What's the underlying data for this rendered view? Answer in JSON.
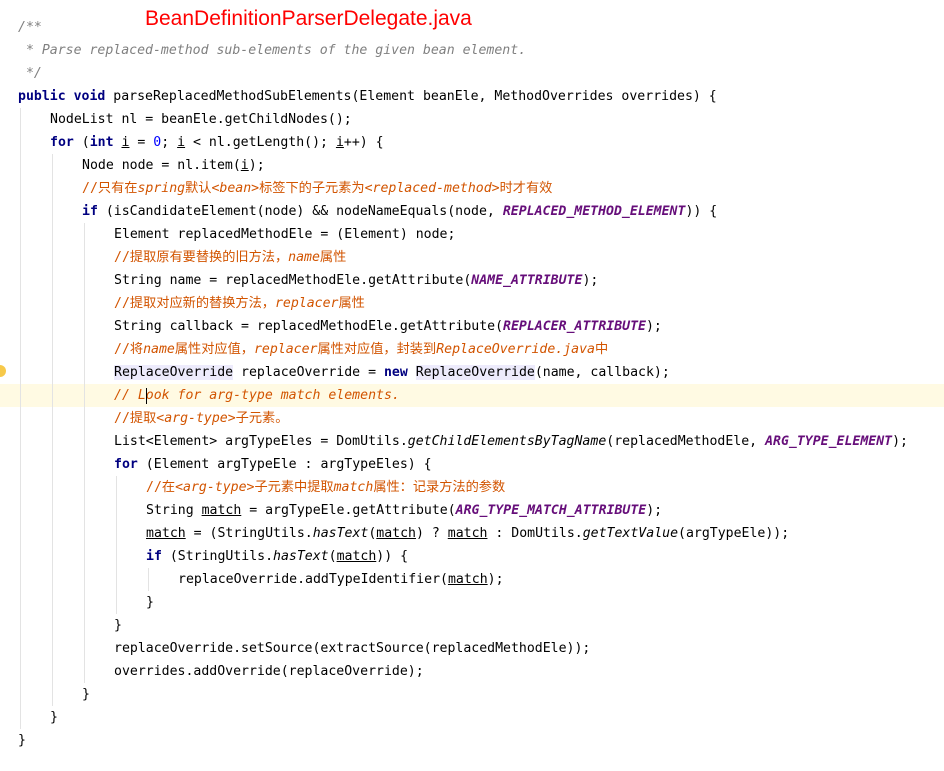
{
  "header": {
    "file_title": "BeanDefinitionParserDelegate.java"
  },
  "editor": {
    "current_line": 16,
    "lines": [
      {
        "indent": 0,
        "tokens": [
          {
            "t": "/**",
            "c": "com"
          }
        ]
      },
      {
        "indent": 0,
        "tokens": [
          {
            "t": " * Parse replaced-method sub-elements of the given bean element.",
            "c": "com"
          }
        ]
      },
      {
        "indent": 0,
        "tokens": [
          {
            "t": " */",
            "c": "com"
          }
        ]
      },
      {
        "indent": 0,
        "tokens": [
          {
            "t": "public",
            "c": "kw"
          },
          {
            "t": " "
          },
          {
            "t": "void",
            "c": "kw"
          },
          {
            "t": " parseReplacedMethodSubElements(Element beanEle, MethodOverrides overrides) {"
          }
        ]
      },
      {
        "indent": 1,
        "tokens": [
          {
            "t": "NodeList nl = beanEle.getChildNodes();"
          }
        ]
      },
      {
        "indent": 1,
        "tokens": [
          {
            "t": "for",
            "c": "kw"
          },
          {
            "t": " ("
          },
          {
            "t": "int",
            "c": "kw"
          },
          {
            "t": " "
          },
          {
            "t": "i",
            "c": "ul"
          },
          {
            "t": " = "
          },
          {
            "t": "0",
            "c": "num"
          },
          {
            "t": "; "
          },
          {
            "t": "i",
            "c": "ul"
          },
          {
            "t": " < nl.getLength(); "
          },
          {
            "t": "i",
            "c": "ul"
          },
          {
            "t": "++) {"
          }
        ]
      },
      {
        "indent": 2,
        "tokens": [
          {
            "t": "Node node = nl.item("
          },
          {
            "t": "i",
            "c": "ul"
          },
          {
            "t": ");"
          }
        ]
      },
      {
        "indent": 2,
        "tokens": [
          {
            "t": "//",
            "c": "cc"
          },
          {
            "t": "只有在",
            "c": "cn"
          },
          {
            "t": "spring",
            "c": "tag"
          },
          {
            "t": "默认",
            "c": "cn"
          },
          {
            "t": "<bean>",
            "c": "tag"
          },
          {
            "t": "标签下的子元素为",
            "c": "cn"
          },
          {
            "t": "<replaced-method>",
            "c": "tag"
          },
          {
            "t": "时才有效",
            "c": "cn"
          }
        ]
      },
      {
        "indent": 2,
        "tokens": [
          {
            "t": "if",
            "c": "kw"
          },
          {
            "t": " (isCandidateElement(node) && nodeNameEquals(node, "
          },
          {
            "t": "REPLACED_METHOD_ELEMENT",
            "c": "const"
          },
          {
            "t": ")) {"
          }
        ]
      },
      {
        "indent": 3,
        "tokens": [
          {
            "t": "Element replacedMethodEle = (Element) node;"
          }
        ]
      },
      {
        "indent": 3,
        "tokens": [
          {
            "t": "//",
            "c": "cc"
          },
          {
            "t": "提取原有要替换的旧方法，",
            "c": "cn"
          },
          {
            "t": "name",
            "c": "tag"
          },
          {
            "t": "属性",
            "c": "cn"
          }
        ]
      },
      {
        "indent": 3,
        "tokens": [
          {
            "t": "String name = replacedMethodEle.getAttribute("
          },
          {
            "t": "NAME_ATTRIBUTE",
            "c": "const"
          },
          {
            "t": ");"
          }
        ]
      },
      {
        "indent": 3,
        "tokens": [
          {
            "t": "//",
            "c": "cc"
          },
          {
            "t": "提取对应新的替换方法，",
            "c": "cn"
          },
          {
            "t": "replacer",
            "c": "tag"
          },
          {
            "t": "属性",
            "c": "cn"
          }
        ]
      },
      {
        "indent": 3,
        "tokens": [
          {
            "t": "String callback = replacedMethodEle.getAttribute("
          },
          {
            "t": "REPLACER_ATTRIBUTE",
            "c": "const"
          },
          {
            "t": ");"
          }
        ]
      },
      {
        "indent": 3,
        "tokens": [
          {
            "t": "//",
            "c": "cc"
          },
          {
            "t": "将",
            "c": "cn"
          },
          {
            "t": "name",
            "c": "tag"
          },
          {
            "t": "属性对应值，",
            "c": "cn"
          },
          {
            "t": "replacer",
            "c": "tag"
          },
          {
            "t": "属性对应值，封装到",
            "c": "cn"
          },
          {
            "t": "ReplaceOverride.java",
            "c": "tag"
          },
          {
            "t": "中",
            "c": "cn"
          }
        ]
      },
      {
        "indent": 3,
        "tokens": [
          {
            "t": "ReplaceOverride",
            "c": "hl"
          },
          {
            "t": " replaceOverride = "
          },
          {
            "t": "new",
            "c": "kw"
          },
          {
            "t": " "
          },
          {
            "t": "ReplaceOverride",
            "c": "hl"
          },
          {
            "t": "(name, callback);"
          }
        ]
      },
      {
        "indent": 3,
        "tokens": [
          {
            "t": "// Look for arg-type match elements.",
            "c": "tag"
          }
        ]
      },
      {
        "indent": 3,
        "tokens": [
          {
            "t": "//",
            "c": "cc"
          },
          {
            "t": "提取",
            "c": "cn"
          },
          {
            "t": "<arg-type>",
            "c": "tag"
          },
          {
            "t": "子元素。",
            "c": "cn"
          }
        ]
      },
      {
        "indent": 3,
        "tokens": [
          {
            "t": "List<Element> argTypeEles = DomUtils."
          },
          {
            "t": "getChildElementsByTagName",
            "c": "static"
          },
          {
            "t": "(replacedMethodEle, "
          },
          {
            "t": "ARG_TYPE_ELEMENT",
            "c": "const"
          },
          {
            "t": ");"
          }
        ]
      },
      {
        "indent": 3,
        "tokens": [
          {
            "t": "for",
            "c": "kw"
          },
          {
            "t": " (Element argTypeEle : argTypeEles) {"
          }
        ]
      },
      {
        "indent": 4,
        "tokens": [
          {
            "t": "//",
            "c": "cc"
          },
          {
            "t": "在",
            "c": "cn"
          },
          {
            "t": "<arg-type>",
            "c": "tag"
          },
          {
            "t": "子元素中提取",
            "c": "cn"
          },
          {
            "t": "match",
            "c": "tag"
          },
          {
            "t": "属性：记录方法的参数",
            "c": "cn"
          }
        ]
      },
      {
        "indent": 4,
        "tokens": [
          {
            "t": "String "
          },
          {
            "t": "match",
            "c": "ul"
          },
          {
            "t": " = argTypeEle.getAttribute("
          },
          {
            "t": "ARG_TYPE_MATCH_ATTRIBUTE",
            "c": "const"
          },
          {
            "t": ");"
          }
        ]
      },
      {
        "indent": 4,
        "tokens": [
          {
            "t": "match",
            "c": "ul"
          },
          {
            "t": " = (StringUtils."
          },
          {
            "t": "hasText",
            "c": "static"
          },
          {
            "t": "("
          },
          {
            "t": "match",
            "c": "ul"
          },
          {
            "t": ") ? "
          },
          {
            "t": "match",
            "c": "ul"
          },
          {
            "t": " : DomUtils."
          },
          {
            "t": "getTextValue",
            "c": "static"
          },
          {
            "t": "(argTypeEle));"
          }
        ]
      },
      {
        "indent": 4,
        "tokens": [
          {
            "t": "if",
            "c": "kw"
          },
          {
            "t": " (StringUtils."
          },
          {
            "t": "hasText",
            "c": "static"
          },
          {
            "t": "("
          },
          {
            "t": "match",
            "c": "ul"
          },
          {
            "t": ")) {"
          }
        ]
      },
      {
        "indent": 5,
        "tokens": [
          {
            "t": "replaceOverride.addTypeIdentifier("
          },
          {
            "t": "match",
            "c": "ul"
          },
          {
            "t": ");"
          }
        ]
      },
      {
        "indent": 4,
        "tokens": [
          {
            "t": "}"
          }
        ]
      },
      {
        "indent": 3,
        "tokens": [
          {
            "t": "}"
          }
        ]
      },
      {
        "indent": 3,
        "tokens": [
          {
            "t": "replaceOverride.setSource(extractSource(replacedMethodEle));"
          }
        ]
      },
      {
        "indent": 3,
        "tokens": [
          {
            "t": "overrides.addOverride(replaceOverride);"
          }
        ]
      },
      {
        "indent": 2,
        "tokens": [
          {
            "t": "}"
          }
        ]
      },
      {
        "indent": 1,
        "tokens": [
          {
            "t": "}"
          }
        ]
      },
      {
        "indent": 0,
        "tokens": [
          {
            "t": "}"
          }
        ]
      }
    ]
  }
}
